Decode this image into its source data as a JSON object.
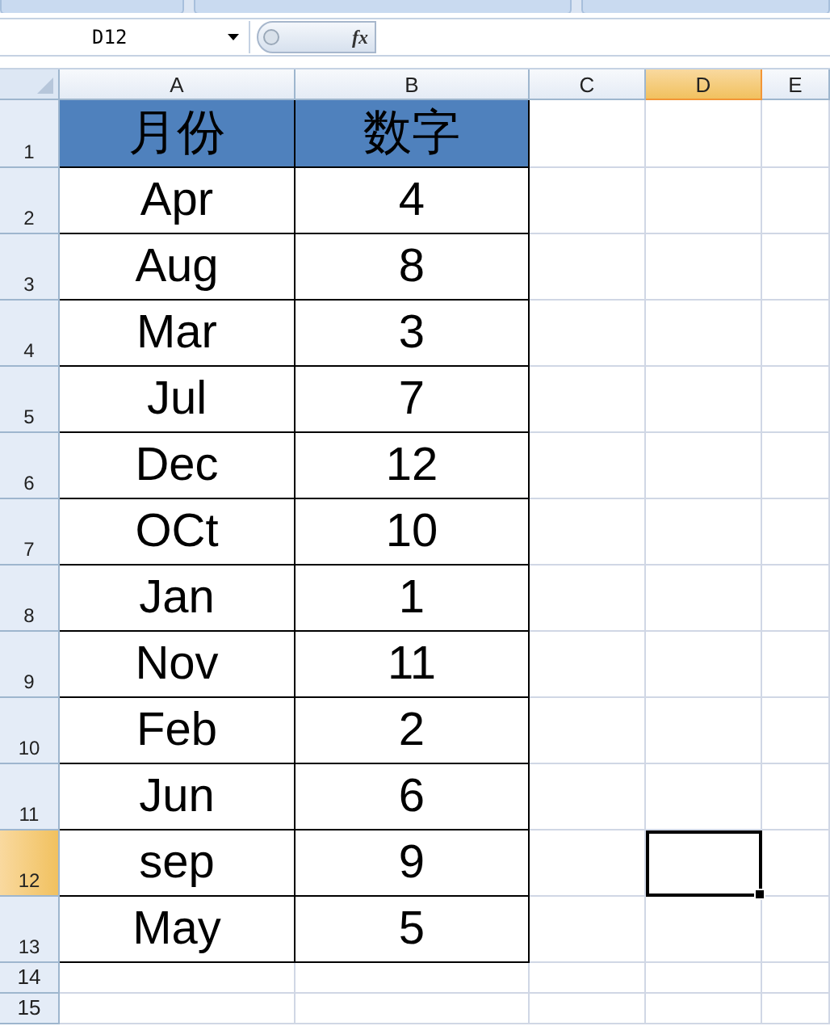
{
  "formula_bar": {
    "name_box": "D12",
    "fx": "fx"
  },
  "columns": [
    {
      "label": "A",
      "selected": false
    },
    {
      "label": "B",
      "selected": false
    },
    {
      "label": "C",
      "selected": false
    },
    {
      "label": "D",
      "selected": true
    },
    {
      "label": "E",
      "selected": false
    }
  ],
  "rows": [
    {
      "number": "1",
      "selected": false,
      "kind": "header",
      "cells": [
        "月份",
        "数字"
      ]
    },
    {
      "number": "2",
      "selected": false,
      "kind": "data",
      "cells": [
        "Apr",
        "4"
      ]
    },
    {
      "number": "3",
      "selected": false,
      "kind": "data",
      "cells": [
        "Aug",
        "8"
      ]
    },
    {
      "number": "4",
      "selected": false,
      "kind": "data",
      "cells": [
        "Mar",
        "3"
      ]
    },
    {
      "number": "5",
      "selected": false,
      "kind": "data",
      "cells": [
        "Jul",
        "7"
      ]
    },
    {
      "number": "6",
      "selected": false,
      "kind": "data",
      "cells": [
        "Dec",
        "12"
      ]
    },
    {
      "number": "7",
      "selected": false,
      "kind": "data",
      "cells": [
        "OCt",
        "10"
      ]
    },
    {
      "number": "8",
      "selected": false,
      "kind": "data",
      "cells": [
        "Jan",
        "1"
      ]
    },
    {
      "number": "9",
      "selected": false,
      "kind": "data",
      "cells": [
        "Nov",
        "11"
      ]
    },
    {
      "number": "10",
      "selected": false,
      "kind": "data",
      "cells": [
        "Feb",
        "2"
      ]
    },
    {
      "number": "11",
      "selected": false,
      "kind": "data",
      "cells": [
        "Jun",
        "6"
      ]
    },
    {
      "number": "12",
      "selected": true,
      "kind": "data",
      "cells": [
        "sep",
        "9"
      ]
    },
    {
      "number": "13",
      "selected": false,
      "kind": "data",
      "cells": [
        "May",
        "5"
      ]
    },
    {
      "number": "14",
      "selected": false,
      "kind": "empty"
    },
    {
      "number": "15",
      "selected": false,
      "kind": "empty"
    }
  ]
}
